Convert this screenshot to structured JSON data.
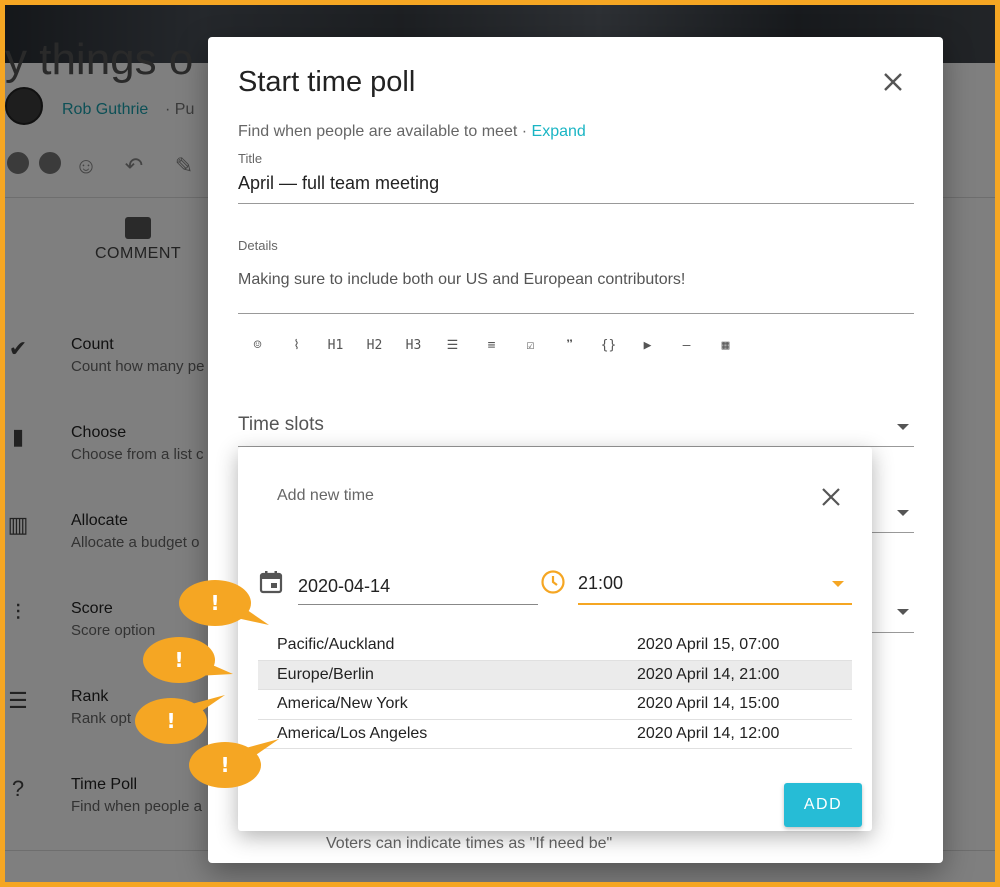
{
  "background": {
    "title_fragment": "y things o",
    "author": "Rob Guthrie",
    "visibility": "· Pu",
    "comment_label": "COMMENT",
    "poll_types": [
      {
        "title": "Count",
        "desc": "Count how many pe",
        "icon": "check-circle-icon"
      },
      {
        "title": "Choose",
        "desc": "Choose from a list c",
        "icon": "bar-chart-icon"
      },
      {
        "title": "Allocate",
        "desc": "Allocate a budget o",
        "icon": "allocate-chart-icon"
      },
      {
        "title": "Score",
        "desc": "Score option",
        "icon": "sliders-icon"
      },
      {
        "title": "Rank",
        "desc": "Rank opt",
        "icon": "ranked-list-icon"
      },
      {
        "title": "Time Poll",
        "desc": "Find when people a",
        "icon": "calendar-question-icon"
      }
    ],
    "behind_text": "Voters can indicate times as \"If need be\""
  },
  "dialog": {
    "title": "Start time poll",
    "subtitle": "Find when people are available to meet · ",
    "expand_link": "Expand",
    "title_field": {
      "label": "Title",
      "value": "April — full team meeting"
    },
    "details_field": {
      "label": "Details",
      "value": "Making sure to include both our US and European contributors!"
    },
    "toolbar": [
      {
        "name": "emoji-icon",
        "glyph": "☺"
      },
      {
        "name": "attachment-icon",
        "glyph": "⌇"
      },
      {
        "name": "h1-button",
        "glyph": "H1"
      },
      {
        "name": "h2-button",
        "glyph": "H2"
      },
      {
        "name": "h3-button",
        "glyph": "H3"
      },
      {
        "name": "bullet-list-icon",
        "glyph": "☰"
      },
      {
        "name": "numbered-list-icon",
        "glyph": "≡"
      },
      {
        "name": "checklist-icon",
        "glyph": "☑"
      },
      {
        "name": "quote-icon",
        "glyph": "❞"
      },
      {
        "name": "code-icon",
        "glyph": "{}"
      },
      {
        "name": "video-icon",
        "glyph": "▶"
      },
      {
        "name": "divider-icon",
        "glyph": "—"
      },
      {
        "name": "table-icon",
        "glyph": "▦"
      }
    ],
    "time_slots_label": "Time slots"
  },
  "add_time": {
    "title": "Add new time",
    "date": "2020-04-14",
    "time": "21:00",
    "timezones": [
      {
        "zone": "Pacific/Auckland",
        "time": "2020 April 15, 07:00",
        "highlight": false
      },
      {
        "zone": "Europe/Berlin",
        "time": "2020 April 14, 21:00",
        "highlight": true
      },
      {
        "zone": "America/New York",
        "time": "2020 April 14, 15:00",
        "highlight": false
      },
      {
        "zone": "America/Los Angeles",
        "time": "2020 April 14, 12:00",
        "highlight": false
      }
    ],
    "add_label": "ADD"
  },
  "annotations": {
    "glyph": "!",
    "color": "#f5a623",
    "count": 4
  },
  "colors": {
    "accent": "#1ab5c4",
    "warning": "#f5a623",
    "button": "#26bcd6"
  }
}
